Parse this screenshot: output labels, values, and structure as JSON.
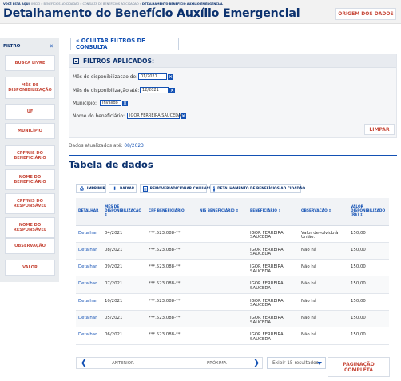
{
  "breadcrumb": {
    "prefix": "VOCÊ ESTÁ AQUI:",
    "trail": "INÍCIO » BENEFÍCIOS AO CIDADÃO » CONSULTA DE BENEFÍCIOS AO CIDADÃO »",
    "current": "DETALHAMENTO BENEFÍCIO AUXÍLIO EMERGENCIAL"
  },
  "page_title": "Detalhamento do Benefício Auxílio Emergencial",
  "origin_button": "ORIGEM DOS DADOS",
  "sidebar": {
    "title": "FILTRO",
    "collapse_icon": "«",
    "items": [
      {
        "label": "BUSCA LIVRE"
      },
      {
        "label": "MÊS DE DISPONIBILIZAÇÃO"
      },
      {
        "label": "UF"
      },
      {
        "label": "MUNICÍPIO"
      },
      {
        "label": "CPF/NIS DO BENEFICIÁRIO"
      },
      {
        "label": "NOME DO BENEFICIÁRIO"
      },
      {
        "label": "CPF/NIS DO RESPONSÁVEL"
      },
      {
        "label": "NOME DO RESPONSÁVEL"
      },
      {
        "label": "OBSERVAÇÃO"
      },
      {
        "label": "VALOR"
      }
    ]
  },
  "hide_filters": "« OCULTAR FILTROS DE CONSULTA",
  "filters": {
    "title": "FILTROS APLICADOS:",
    "from_label": "Mês de disponibilizacao de:",
    "from_value": "01/2021",
    "to_label": "Mês de disponibilização até:",
    "to_value": "12/2021",
    "city_label": "Município:",
    "city_value": "Inválido",
    "name_label": "Nome do beneficiário:",
    "name_value": "IGOR FERREIRA SAUCEDA",
    "remove_icon": "×",
    "clear_button": "LIMPAR"
  },
  "updated": {
    "label": "Dados atualizados até:",
    "date": "08/2023"
  },
  "table_title": "Tabela de dados",
  "toolbar": {
    "print": "IMPRIMIR",
    "print_icon": "⎙",
    "download": "BAIXAR",
    "download_icon": "⬇",
    "columns": "REMOVER/ADICIONAR COLUNAS",
    "columns_icon": "▥",
    "detail": "DETALHAMENTO DE BENEFÍCIOS AO CIDADÃO",
    "detail_icon": "‹"
  },
  "table": {
    "headers": [
      "DETALHAR",
      "MÊS DE DISPONIBILIZAÇÃO ⇕",
      "CPF BENEFICIÁRIO",
      "NIS BENEFICIÁRIO ⇕",
      "BENEFICIÁRIO ⇕",
      "OBSERVAÇÃO ⇕",
      "VALOR DISPONIBILIZADO (R$) ⇕"
    ],
    "rows": [
      [
        "Detalhar",
        "04/2021",
        "***.523.088-**",
        "",
        "IGOR FERREIRA SAUCEDA",
        "Valor devolvido à União.",
        "150,00"
      ],
      [
        "Detalhar",
        "08/2021",
        "***.523.088-**",
        "",
        "IGOR FERREIRA SAUCEDA",
        "Não há",
        "150,00"
      ],
      [
        "Detalhar",
        "09/2021",
        "***.523.088-**",
        "",
        "IGOR FERREIRA SAUCEDA",
        "Não há",
        "150,00"
      ],
      [
        "Detalhar",
        "07/2021",
        "***.523.088-**",
        "",
        "IGOR FERREIRA SAUCEDA",
        "Não há",
        "150,00"
      ],
      [
        "Detalhar",
        "10/2021",
        "***.523.088-**",
        "",
        "IGOR FERREIRA SAUCEDA",
        "Não há",
        "150,00"
      ],
      [
        "Detalhar",
        "05/2021",
        "***.523.088-**",
        "",
        "IGOR FERREIRA SAUCEDA",
        "Não há",
        "150,00"
      ],
      [
        "Detalhar",
        "06/2021",
        "***.523.088-**",
        "",
        "IGOR FERREIRA SAUCEDA",
        "Não há",
        "150,00"
      ]
    ]
  },
  "pagination": {
    "prev_icon": "❮",
    "prev_label": "ANTERIOR",
    "next_label": "PRÓXIMA",
    "next_icon": "❯",
    "results": "Exibir 15 resultados",
    "full_page": "PAGINAÇÃO COMPLETA"
  },
  "colors": {
    "primary": "#0c326f",
    "link": "#1351b4",
    "accent": "#c74a3b",
    "panel": "#e9ecef"
  }
}
